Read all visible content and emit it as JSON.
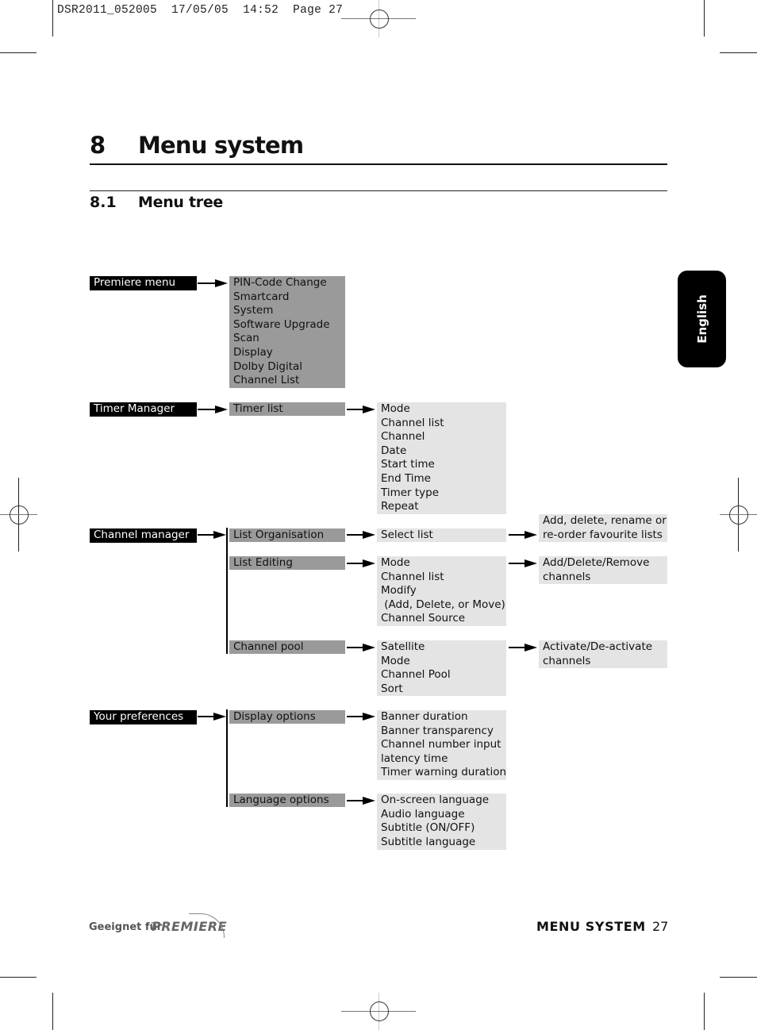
{
  "slug": {
    "file": "DSR2011_052005",
    "date": "17/05/05",
    "time": "14:52",
    "page_label": "Page",
    "page": "27"
  },
  "chapter": {
    "number": "8",
    "title": "Menu system"
  },
  "section": {
    "number": "8.1",
    "title": "Menu tree"
  },
  "side_tab": "English",
  "menu_tree": [
    {
      "root": "Premiere menu",
      "children": [
        {
          "label_lines": [
            "PIN-Code Change",
            "Smartcard",
            "System",
            "Software Upgrade",
            "Scan",
            "Display",
            "Dolby Digital",
            "Channel List"
          ]
        }
      ]
    },
    {
      "root": "Timer Manager",
      "children": [
        {
          "label": "Timer list",
          "leaf": [
            "Mode",
            "Channel list",
            "Channel",
            "Date",
            "Start time",
            "End Time",
            "Timer type",
            "Repeat"
          ]
        }
      ]
    },
    {
      "root": "Channel manager",
      "children": [
        {
          "label": "List Organisation",
          "leaf": [
            "Select list"
          ],
          "leaf2": [
            "Add, delete, rename or",
            "re-order favourite lists"
          ]
        },
        {
          "label": "List Editing",
          "leaf": [
            "Mode",
            "Channel list",
            "Modify",
            " (Add, Delete, or Move)",
            "Channel Source"
          ],
          "leaf2": [
            "Add/Delete/Remove",
            "channels"
          ]
        },
        {
          "label": "Channel pool",
          "leaf": [
            "Satellite",
            "Mode",
            "Channel Pool",
            "Sort"
          ],
          "leaf2": [
            "Activate/De-activate",
            "channels"
          ]
        }
      ]
    },
    {
      "root": "Your preferences",
      "children": [
        {
          "label": "Display options",
          "leaf": [
            "Banner duration",
            "Banner transparency",
            "Channel number input",
            "latency time",
            "Timer warning duration"
          ]
        },
        {
          "label": "Language options",
          "leaf": [
            "On-screen language",
            "Audio language",
            "Subtitle (ON/OFF)",
            "Subtitle language"
          ]
        }
      ]
    }
  ],
  "footer": {
    "logo_prefix": "Geeignet für",
    "logo_brand": "PREMIERE",
    "section_label": "MENU SYSTEM",
    "page_number": "27"
  }
}
